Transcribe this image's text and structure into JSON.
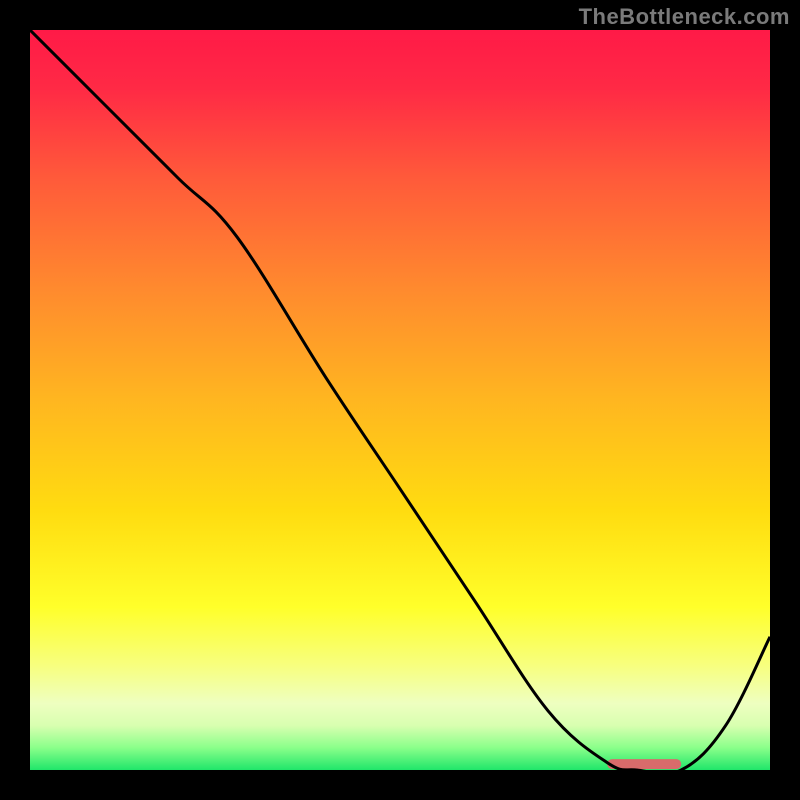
{
  "watermark": "TheBottleneck.com",
  "chart_data": {
    "type": "line",
    "title": "",
    "xlabel": "",
    "ylabel": "",
    "xlim": [
      0,
      100
    ],
    "ylim": [
      0,
      100
    ],
    "grid": false,
    "legend": false,
    "series": [
      {
        "name": "curve",
        "x": [
          0,
          10,
          20,
          28,
          40,
          50,
          60,
          70,
          78,
          82,
          88,
          94,
          100
        ],
        "y": [
          100,
          90,
          80,
          72,
          53,
          38,
          23,
          8,
          1,
          0,
          0,
          6,
          18
        ]
      }
    ],
    "marker": {
      "x_start": 78,
      "x_end": 88,
      "y": 0.8,
      "color": "#d86b6b"
    },
    "gradient_stops": [
      {
        "offset": 0.0,
        "color": "#ff1a47"
      },
      {
        "offset": 0.08,
        "color": "#ff2a45"
      },
      {
        "offset": 0.2,
        "color": "#ff5a3a"
      },
      {
        "offset": 0.35,
        "color": "#ff8a2e"
      },
      {
        "offset": 0.5,
        "color": "#ffb620"
      },
      {
        "offset": 0.65,
        "color": "#ffdc10"
      },
      {
        "offset": 0.78,
        "color": "#ffff2a"
      },
      {
        "offset": 0.86,
        "color": "#f7ff80"
      },
      {
        "offset": 0.91,
        "color": "#eeffc0"
      },
      {
        "offset": 0.94,
        "color": "#d8ffb0"
      },
      {
        "offset": 0.97,
        "color": "#8aff8a"
      },
      {
        "offset": 1.0,
        "color": "#20e66a"
      }
    ]
  }
}
